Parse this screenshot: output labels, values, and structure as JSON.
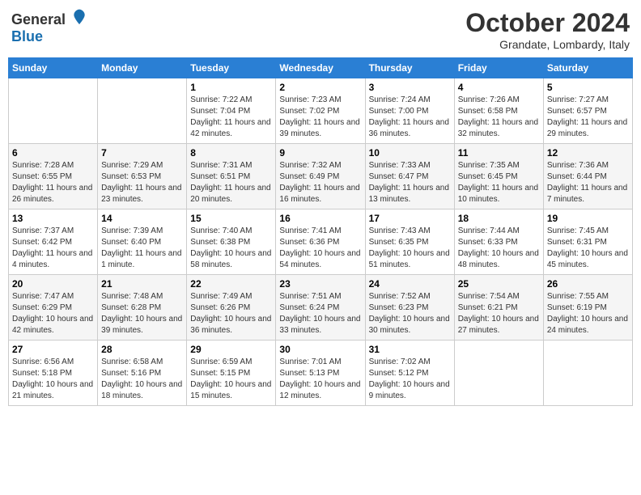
{
  "header": {
    "logo_general": "General",
    "logo_blue": "Blue",
    "month": "October 2024",
    "location": "Grandate, Lombardy, Italy"
  },
  "weekdays": [
    "Sunday",
    "Monday",
    "Tuesday",
    "Wednesday",
    "Thursday",
    "Friday",
    "Saturday"
  ],
  "weeks": [
    [
      {
        "day": "",
        "sunrise": "",
        "sunset": "",
        "daylight": ""
      },
      {
        "day": "",
        "sunrise": "",
        "sunset": "",
        "daylight": ""
      },
      {
        "day": "1",
        "sunrise": "Sunrise: 7:22 AM",
        "sunset": "Sunset: 7:04 PM",
        "daylight": "Daylight: 11 hours and 42 minutes."
      },
      {
        "day": "2",
        "sunrise": "Sunrise: 7:23 AM",
        "sunset": "Sunset: 7:02 PM",
        "daylight": "Daylight: 11 hours and 39 minutes."
      },
      {
        "day": "3",
        "sunrise": "Sunrise: 7:24 AM",
        "sunset": "Sunset: 7:00 PM",
        "daylight": "Daylight: 11 hours and 36 minutes."
      },
      {
        "day": "4",
        "sunrise": "Sunrise: 7:26 AM",
        "sunset": "Sunset: 6:58 PM",
        "daylight": "Daylight: 11 hours and 32 minutes."
      },
      {
        "day": "5",
        "sunrise": "Sunrise: 7:27 AM",
        "sunset": "Sunset: 6:57 PM",
        "daylight": "Daylight: 11 hours and 29 minutes."
      }
    ],
    [
      {
        "day": "6",
        "sunrise": "Sunrise: 7:28 AM",
        "sunset": "Sunset: 6:55 PM",
        "daylight": "Daylight: 11 hours and 26 minutes."
      },
      {
        "day": "7",
        "sunrise": "Sunrise: 7:29 AM",
        "sunset": "Sunset: 6:53 PM",
        "daylight": "Daylight: 11 hours and 23 minutes."
      },
      {
        "day": "8",
        "sunrise": "Sunrise: 7:31 AM",
        "sunset": "Sunset: 6:51 PM",
        "daylight": "Daylight: 11 hours and 20 minutes."
      },
      {
        "day": "9",
        "sunrise": "Sunrise: 7:32 AM",
        "sunset": "Sunset: 6:49 PM",
        "daylight": "Daylight: 11 hours and 16 minutes."
      },
      {
        "day": "10",
        "sunrise": "Sunrise: 7:33 AM",
        "sunset": "Sunset: 6:47 PM",
        "daylight": "Daylight: 11 hours and 13 minutes."
      },
      {
        "day": "11",
        "sunrise": "Sunrise: 7:35 AM",
        "sunset": "Sunset: 6:45 PM",
        "daylight": "Daylight: 11 hours and 10 minutes."
      },
      {
        "day": "12",
        "sunrise": "Sunrise: 7:36 AM",
        "sunset": "Sunset: 6:44 PM",
        "daylight": "Daylight: 11 hours and 7 minutes."
      }
    ],
    [
      {
        "day": "13",
        "sunrise": "Sunrise: 7:37 AM",
        "sunset": "Sunset: 6:42 PM",
        "daylight": "Daylight: 11 hours and 4 minutes."
      },
      {
        "day": "14",
        "sunrise": "Sunrise: 7:39 AM",
        "sunset": "Sunset: 6:40 PM",
        "daylight": "Daylight: 11 hours and 1 minute."
      },
      {
        "day": "15",
        "sunrise": "Sunrise: 7:40 AM",
        "sunset": "Sunset: 6:38 PM",
        "daylight": "Daylight: 10 hours and 58 minutes."
      },
      {
        "day": "16",
        "sunrise": "Sunrise: 7:41 AM",
        "sunset": "Sunset: 6:36 PM",
        "daylight": "Daylight: 10 hours and 54 minutes."
      },
      {
        "day": "17",
        "sunrise": "Sunrise: 7:43 AM",
        "sunset": "Sunset: 6:35 PM",
        "daylight": "Daylight: 10 hours and 51 minutes."
      },
      {
        "day": "18",
        "sunrise": "Sunrise: 7:44 AM",
        "sunset": "Sunset: 6:33 PM",
        "daylight": "Daylight: 10 hours and 48 minutes."
      },
      {
        "day": "19",
        "sunrise": "Sunrise: 7:45 AM",
        "sunset": "Sunset: 6:31 PM",
        "daylight": "Daylight: 10 hours and 45 minutes."
      }
    ],
    [
      {
        "day": "20",
        "sunrise": "Sunrise: 7:47 AM",
        "sunset": "Sunset: 6:29 PM",
        "daylight": "Daylight: 10 hours and 42 minutes."
      },
      {
        "day": "21",
        "sunrise": "Sunrise: 7:48 AM",
        "sunset": "Sunset: 6:28 PM",
        "daylight": "Daylight: 10 hours and 39 minutes."
      },
      {
        "day": "22",
        "sunrise": "Sunrise: 7:49 AM",
        "sunset": "Sunset: 6:26 PM",
        "daylight": "Daylight: 10 hours and 36 minutes."
      },
      {
        "day": "23",
        "sunrise": "Sunrise: 7:51 AM",
        "sunset": "Sunset: 6:24 PM",
        "daylight": "Daylight: 10 hours and 33 minutes."
      },
      {
        "day": "24",
        "sunrise": "Sunrise: 7:52 AM",
        "sunset": "Sunset: 6:23 PM",
        "daylight": "Daylight: 10 hours and 30 minutes."
      },
      {
        "day": "25",
        "sunrise": "Sunrise: 7:54 AM",
        "sunset": "Sunset: 6:21 PM",
        "daylight": "Daylight: 10 hours and 27 minutes."
      },
      {
        "day": "26",
        "sunrise": "Sunrise: 7:55 AM",
        "sunset": "Sunset: 6:19 PM",
        "daylight": "Daylight: 10 hours and 24 minutes."
      }
    ],
    [
      {
        "day": "27",
        "sunrise": "Sunrise: 6:56 AM",
        "sunset": "Sunset: 5:18 PM",
        "daylight": "Daylight: 10 hours and 21 minutes."
      },
      {
        "day": "28",
        "sunrise": "Sunrise: 6:58 AM",
        "sunset": "Sunset: 5:16 PM",
        "daylight": "Daylight: 10 hours and 18 minutes."
      },
      {
        "day": "29",
        "sunrise": "Sunrise: 6:59 AM",
        "sunset": "Sunset: 5:15 PM",
        "daylight": "Daylight: 10 hours and 15 minutes."
      },
      {
        "day": "30",
        "sunrise": "Sunrise: 7:01 AM",
        "sunset": "Sunset: 5:13 PM",
        "daylight": "Daylight: 10 hours and 12 minutes."
      },
      {
        "day": "31",
        "sunrise": "Sunrise: 7:02 AM",
        "sunset": "Sunset: 5:12 PM",
        "daylight": "Daylight: 10 hours and 9 minutes."
      },
      {
        "day": "",
        "sunrise": "",
        "sunset": "",
        "daylight": ""
      },
      {
        "day": "",
        "sunrise": "",
        "sunset": "",
        "daylight": ""
      }
    ]
  ]
}
